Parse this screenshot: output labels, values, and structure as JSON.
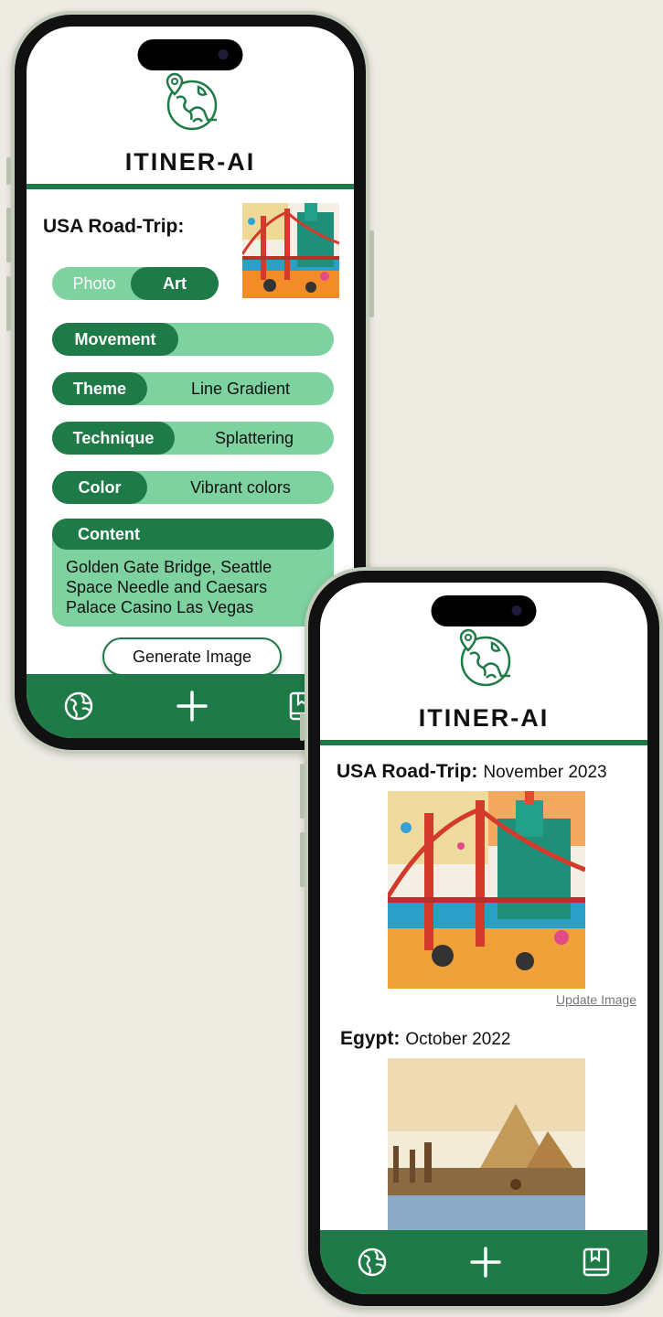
{
  "app": {
    "brand": "ITINER-AI"
  },
  "editor": {
    "trip_title": "USA Road-Trip:",
    "toggle": {
      "photo": "Photo",
      "art": "Art"
    },
    "options": [
      {
        "label": "Movement",
        "value": ""
      },
      {
        "label": "Theme",
        "value": "Line Gradient"
      },
      {
        "label": "Technique",
        "value": "Splattering"
      },
      {
        "label": "Color",
        "value": "Vibrant colors"
      }
    ],
    "content": {
      "label": "Content",
      "text": "Golden Gate Bridge, Seattle Space Needle and Caesars Palace Casino Las Vegas"
    },
    "generate_label": "Generate Image"
  },
  "gallery": {
    "trips": [
      {
        "title": "USA Road-Trip:",
        "date": "November 2023",
        "update_label": "Update Image"
      },
      {
        "title": "Egypt:",
        "date": "October 2022"
      }
    ]
  },
  "nav": {
    "items": [
      "globe-icon",
      "plus-icon",
      "book-icon"
    ]
  },
  "colors": {
    "primary": "#1e7a46",
    "light": "#7ed2a0",
    "background": "#eeebe3"
  }
}
